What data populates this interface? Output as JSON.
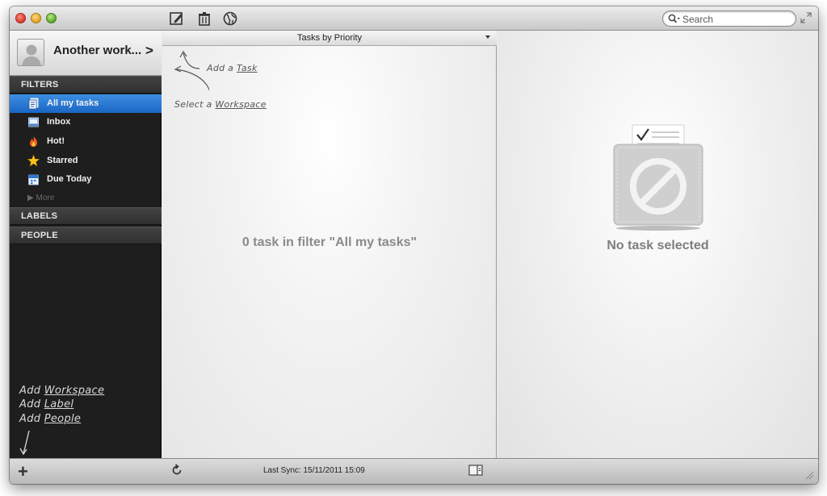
{
  "window": {
    "traffic_lights": [
      "close",
      "minimize",
      "zoom"
    ]
  },
  "toolbar": {
    "icons": [
      "compose-icon",
      "trash-icon",
      "globe-icon"
    ],
    "search_placeholder": "Search"
  },
  "sidebar": {
    "account_name": "Another work...",
    "account_chevron": ">",
    "filters_header": "FILTERS",
    "items": [
      {
        "label": "All my tasks",
        "icon": "tasks-icon",
        "selected": true
      },
      {
        "label": "Inbox",
        "icon": "inbox-icon",
        "selected": false
      },
      {
        "label": "Hot!",
        "icon": "flame-icon",
        "selected": false
      },
      {
        "label": "Starred",
        "icon": "star-icon",
        "selected": false
      },
      {
        "label": "Due Today",
        "icon": "calendar-icon",
        "selected": false
      }
    ],
    "more_label": "More",
    "labels_header": "LABELS",
    "people_header": "PEOPLE",
    "hints": {
      "add_workspace_prefix": "Add",
      "add_workspace_link": "Workspace",
      "add_label_prefix": "Add",
      "add_label_link": "Label",
      "add_people_prefix": "Add",
      "add_people_link": "People"
    }
  },
  "task_list": {
    "header": "Tasks by Priority",
    "hints": {
      "add_task_prefix": "Add a",
      "add_task_link": "Task",
      "select_workspace_prefix": "Select a",
      "select_workspace_link": "Workspace"
    },
    "empty_message": "0 task in filter \"All my tasks\""
  },
  "detail": {
    "empty_label": "No task selected"
  },
  "bottombar": {
    "add_symbol": "+",
    "sync_label": "Last Sync: 15/11/2011 15:09"
  },
  "colors": {
    "sidebar_bg": "#1c1c1c",
    "selection": "#2a7ad6",
    "empty_text": "#8a8a8a"
  }
}
